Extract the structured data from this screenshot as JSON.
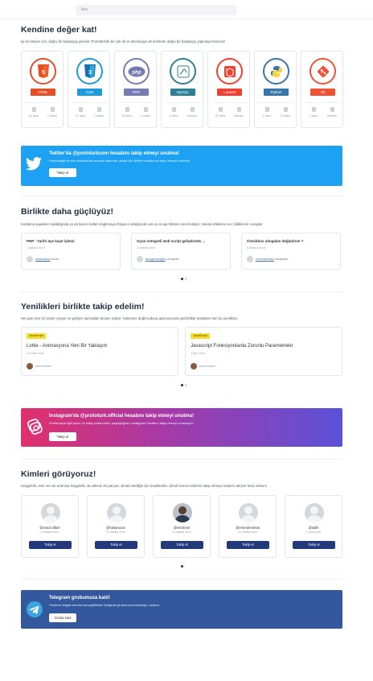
{
  "search": {
    "placeholder": "Ara"
  },
  "hero": {
    "title": "Kendine değer kat!",
    "description": "İyi bir kariyer için, doğru bir başlangıç gerekir. Prototürk'de bir çok dil ve teknolojiye ait derslerle doğru bir başlangıç yapmaya hazırsın!"
  },
  "courses": [
    {
      "label": "HTML",
      "color": "#e44d26",
      "icon": "html5-icon",
      "lessons": "31 ders",
      "videos": "1 video"
    },
    {
      "label": "CSS",
      "color": "#1b9bd7",
      "icon": "css3-icon",
      "lessons": "71 ders",
      "videos": "7 video"
    },
    {
      "label": "PHP",
      "color": "#777bb3",
      "icon": "php-icon",
      "lessons": "59 ders",
      "videos": "1 video"
    },
    {
      "label": "MySQL",
      "color": "#2b7f97",
      "icon": "mysql-icon",
      "lessons": "2 ders",
      "videos": "belirsiz"
    },
    {
      "label": "Laravel",
      "color": "#f0402e",
      "icon": "laravel-icon",
      "lessons": "37 ders",
      "videos": "belirsiz"
    },
    {
      "label": "Python",
      "color": "#3776ab",
      "icon": "python-icon",
      "lessons": "1 ders",
      "videos": "9 video"
    },
    {
      "label": "Git",
      "color": "#f05133",
      "icon": "git-icon",
      "lessons": "2 ders",
      "videos": "belirsiz"
    }
  ],
  "twitter_banner": {
    "title": "Twitter'da @prototurkcom hesabını takip etmeyi unutma!",
    "description": "Hazırladığımız son videolardan anında haberdar olmak için twitter hesabımızı takip etmeyi unutma!",
    "button": "Takip et",
    "color": "#1da1f2"
  },
  "community": {
    "title": "Birlikte daha güçlüyüz!",
    "description": "Kodlama yaparken takıldığında ya da bazen kafam dağıtmaya ihtiyacın olduğunda soru & cevap bölümü seni bekliyor. Merak ettiklerini sor, bildiklerini cevapla!",
    "questions": [
      {
        "title": "PHP - Tarihi üye kayıt işlemi",
        "time": "1 dakika önce",
        "user": "ensarolkan",
        "action": "sordu"
      },
      {
        "title": "Oyun entegreli web script geliştirmek ...",
        "time": "3 dakika önce",
        "user": "mxuguranoglin",
        "action": "cevapladı"
      },
      {
        "title": "Checkbox arkaplanı değiştirme ?",
        "time": "6 dakika önce",
        "user": "emrealiemres",
        "action": "cevapladı"
      }
    ]
  },
  "updates": {
    "title": "Yenilikleri birlikte takip edelim!",
    "description": "Her gün yeni bir şeyler çıkıyor ve gelişim durmadan devam ediyor. Kalemine değil koduna güveniyorsan gel birlikte anlatalım tüm bu yenilikleri.",
    "articles": [
      {
        "badge": "JavaScript",
        "title": "Lottie - Animasyona Yeni Bir Yaklaşım",
        "time": "21 saat önce",
        "author": "tanfurebilen"
      },
      {
        "badge": "JavaScript",
        "title": "Javascript Fonksiyonlarda Zorunlu Parametreler",
        "time": "1 gün önce",
        "author": "tanfurebilen"
      }
    ]
  },
  "instagram_banner": {
    "title": "Instagram'da @prototurk.official hesabını takip etmeyi unutma!",
    "description": "Kodlamayla ilgili ipucu ve kolay kullanımları paylaştığımız Instagram hesabını takip etmeyi unutmayın.",
    "button": "Takip et"
  },
  "people": {
    "title": "Kimleri görüyoruz!",
    "description": "Hoşgeldin, evet sen de aramıza hoşgeldin. Bu ailenin bir parçası olmak istediğin için teşekkürler. Şimdi hemen birilerini takip etmeye başla ki akışım biraz dolsun!",
    "users": [
      {
        "name": "@veazcolban",
        "time": "8 dakika önce",
        "button": "Takip et"
      },
      {
        "name": "@hakanucar",
        "time": "19 dakika önce",
        "button": "Takip et"
      },
      {
        "name": "@verdoros",
        "time": "20 dakika önce",
        "button": "Takip et"
      },
      {
        "name": "@emredemirtas",
        "time": "25 dakika önce",
        "button": "Takip et"
      },
      {
        "name": "@salih",
        "time": "1 saat önce",
        "button": "Takip et"
      }
    ]
  },
  "telegram_banner": {
    "title": "Telegram grubumuza katıl!",
    "description": "Yüzlerce kişiyle anında konuşabilirsin! telegram grubumuza katılmayı unutma.",
    "button": "Gruba katıl",
    "color": "#34589d"
  }
}
